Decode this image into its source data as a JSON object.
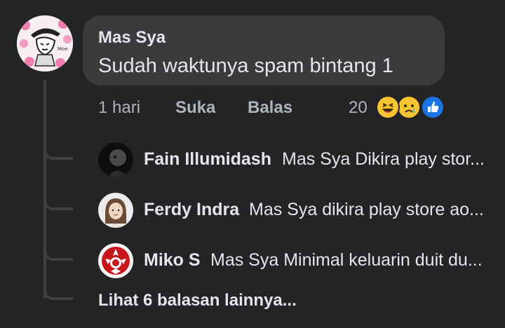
{
  "comment": {
    "author": "Mas Sya",
    "text": "Sudah waktunya spam bintang 1",
    "time": "1 hari",
    "like_label": "Suka",
    "reply_label": "Balas",
    "reaction_count": "20",
    "reactions": [
      "haha-icon",
      "sad-icon",
      "like-icon"
    ]
  },
  "replies": [
    {
      "name": "Fain Illumidash",
      "text": "Mas Sya Dikira play stor...",
      "avatar": "dark-portrait-avatar"
    },
    {
      "name": "Ferdy Indra",
      "text": "Mas Sya dikira play store ao...",
      "avatar": "girl-photo-avatar"
    },
    {
      "name": "Miko S",
      "text": "Mas Sya Minimal keluarin duit du...",
      "avatar": "red-emblem-avatar"
    }
  ],
  "more_replies_label": "Lihat 6 balasan lainnya...",
  "colors": {
    "background": "#232425",
    "bubble": "#3a3b3c",
    "text": "#e4e6eb",
    "muted": "#b0b3b8",
    "like_blue": "#1b74e4",
    "emoji_yellow": "#f7c531"
  }
}
